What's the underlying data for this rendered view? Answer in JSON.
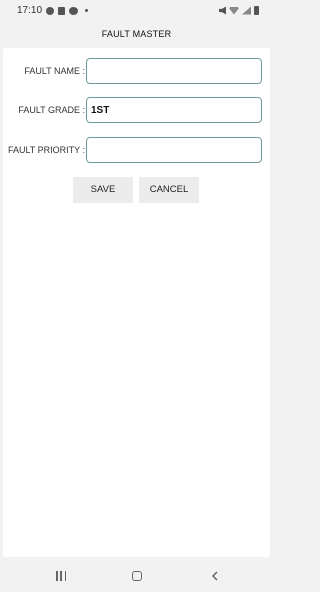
{
  "status_bar": {
    "time": "17:10",
    "left_icons": [
      "gear-icon",
      "bag-icon",
      "cloud-icon",
      "dot-icon"
    ],
    "right_icons": [
      "mute-icon",
      "wifi-icon",
      "signal-icon",
      "battery-icon"
    ]
  },
  "header": {
    "title": "FAULT MASTER"
  },
  "form": {
    "fault_name": {
      "label": "FAULT NAME :",
      "value": ""
    },
    "fault_grade": {
      "label": "FAULT GRADE :",
      "value": "1ST"
    },
    "fault_priority": {
      "label": "FAULT PRIORITY :",
      "value": ""
    }
  },
  "actions": {
    "save_label": "SAVE",
    "cancel_label": "CANCEL"
  },
  "nav_bar": {
    "icons": [
      "recents-icon",
      "home-icon",
      "back-icon"
    ]
  },
  "colors": {
    "background": "#f2f2f2",
    "card": "#ffffff",
    "input_border": "#6f9a9a",
    "button_bg": "#ececec"
  }
}
